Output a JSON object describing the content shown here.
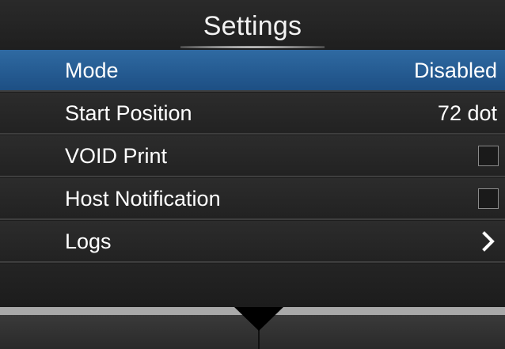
{
  "title": "Settings",
  "items": [
    {
      "label": "Mode",
      "value": "Disabled",
      "kind": "value"
    },
    {
      "label": "Start Position",
      "value": "72 dot",
      "kind": "value"
    },
    {
      "label": "VOID Print",
      "kind": "checkbox",
      "checked": false
    },
    {
      "label": "Host Notification",
      "kind": "checkbox",
      "checked": false
    },
    {
      "label": "Logs",
      "kind": "submenu"
    }
  ],
  "selected_index": 0,
  "colors": {
    "selected_row": "#2f6aa2",
    "background": "#1d1d1d",
    "text": "#ffffff"
  },
  "icons": {
    "logs_chevron": "chevron-right-icon",
    "bottom_arrow": "triangle-down-icon"
  }
}
